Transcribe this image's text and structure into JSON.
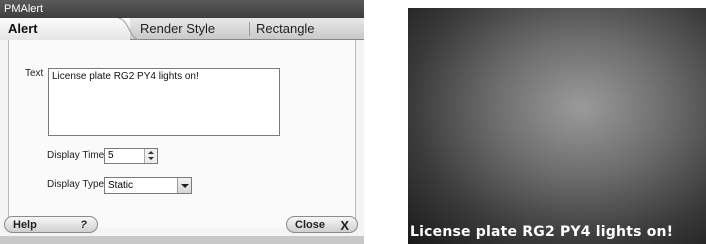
{
  "window": {
    "title": "PMAlert"
  },
  "tabs": [
    {
      "label": "Alert",
      "active": true
    },
    {
      "label": "Render Style",
      "active": false
    },
    {
      "label": "Rectangle",
      "active": false
    }
  ],
  "form": {
    "text_label": "Text",
    "text_value": "License plate RG2 PY4 lights on!",
    "display_time_label": "Display Time",
    "display_time_value": "5",
    "display_type_label": "Display Type",
    "display_type_value": "Static"
  },
  "buttons": {
    "help_label": "Help",
    "help_glyph": "?",
    "close_label": "Close",
    "close_glyph": "X"
  },
  "preview": {
    "caption": "License plate RG2 PY4 lights on!"
  },
  "colors": {
    "titlebar": "#4a4a4a",
    "caption_text": "#ffffff"
  }
}
